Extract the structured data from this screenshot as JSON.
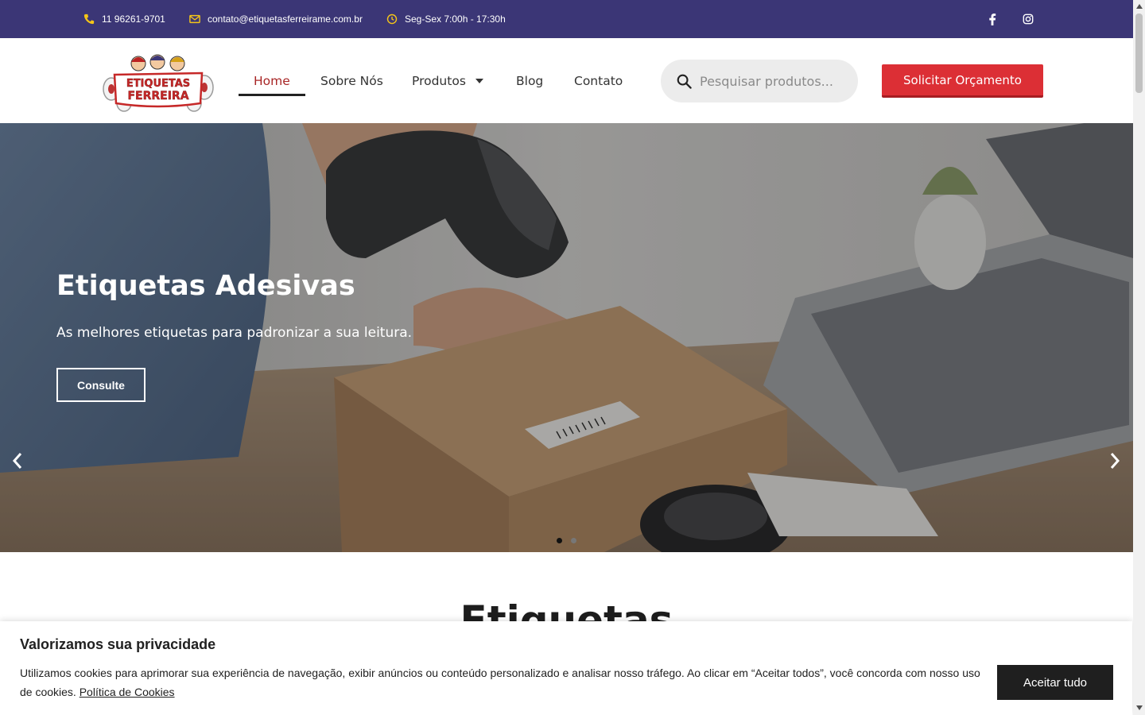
{
  "topbar": {
    "phone": "11 96261-9701",
    "email": "contato@etiquetasferreirame.com.br",
    "hours": "Seg-Sex 7:00h - 17:30h",
    "icons": [
      "phone-icon",
      "envelope-icon",
      "clock-icon",
      "facebook-icon",
      "instagram-icon"
    ]
  },
  "header": {
    "logo_text_line1": "ETIQUETAS",
    "logo_text_line2": "FERREIRA",
    "nav": {
      "home": "Home",
      "about": "Sobre Nós",
      "products": "Produtos",
      "blog": "Blog",
      "contact": "Contato"
    },
    "search_placeholder": "Pesquisar produtos...",
    "cta_label": "Solicitar Orçamento"
  },
  "hero": {
    "title": "Etiquetas Adesivas",
    "subtitle": "As melhores etiquetas para padronizar a sua leitura.",
    "button_label": "Consulte",
    "slide_count": 2,
    "active_slide": 1
  },
  "section": {
    "title": "Etiquetas"
  },
  "cookie": {
    "title": "Valorizamos sua privacidade",
    "text": "Utilizamos cookies para aprimorar sua experiência de navegação, exibir anúncios ou conteúdo personalizado e analisar nosso tráfego. Ao clicar em “Aceitar todos”, você concorda com nosso uso de cookies.",
    "link_label": "Política de Cookies",
    "button_label": "Aceitar tudo"
  },
  "colors": {
    "topbar": "#3b3676",
    "accent_red": "#dc2f35",
    "active_nav": "#a82626",
    "icon_yellow": "#f5c518"
  }
}
